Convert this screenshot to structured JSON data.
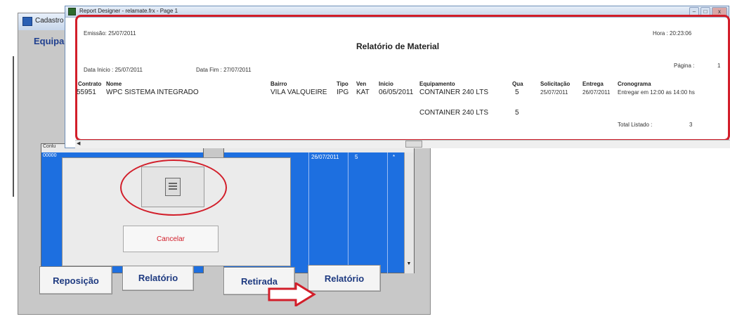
{
  "back_window": {
    "title": "Cadastro",
    "heading": "Equipa",
    "left_table": {
      "header": "Conlu",
      "row": "00000"
    },
    "right_table": {
      "row": {
        "date": "26/07/2011",
        "qty": "5",
        "extra": "*"
      }
    },
    "buttons": {
      "reposicao": "Reposição",
      "relatorio_left": "Relatório",
      "retirada": "Retirada",
      "relatorio_right": "Relatório"
    }
  },
  "dialog": {
    "cancel_label": "Cancelar"
  },
  "report_window": {
    "title": "Report Designer - relamate.frx - Page 1",
    "controls": {
      "minimize": "–",
      "maximize": "□",
      "close": "x"
    },
    "emissao": "Emissão: 25/07/2011",
    "hora": "Hora : 20:23:06",
    "report_title": "Relatório de Material",
    "data_inicio": "Data Inicio : 25/07/2011",
    "data_fim": "Data Fim : 27/07/2011",
    "pagina_label": "Página :",
    "pagina_value": "1",
    "columns": {
      "contrato": "Contrato",
      "nome": "Nome",
      "bairro": "Bairro",
      "tipo": "Tipo",
      "ven": "Ven",
      "inicio": "Inicio",
      "equipamento": "Equipamento",
      "qua": "Qua",
      "solicitacao": "Solicitação",
      "entrega": "Entrega",
      "cronograma": "Cronograma"
    },
    "rows": [
      {
        "contrato": "55951",
        "nome": "WPC SISTEMA INTEGRADO",
        "bairro": "VILA VALQUEIRE",
        "tipo": "IPG",
        "ven": "KAT",
        "inicio": "06/05/2011",
        "equipamento": "CONTAINER 240 LTS",
        "qua": "5",
        "solicitacao": "25/07/2011",
        "entrega": "26/07/2011",
        "cronograma": "Entregar em 12:00 as 14:00 hs"
      }
    ],
    "summary": {
      "equipamento": "CONTAINER 240 LTS",
      "qua": "5"
    },
    "total_label": "Total Listado :",
    "total_value": "3"
  },
  "colors": {
    "highlight_red": "#d21e2a",
    "grid_blue": "#1d6fe0",
    "button_text": "#1e3a80"
  }
}
